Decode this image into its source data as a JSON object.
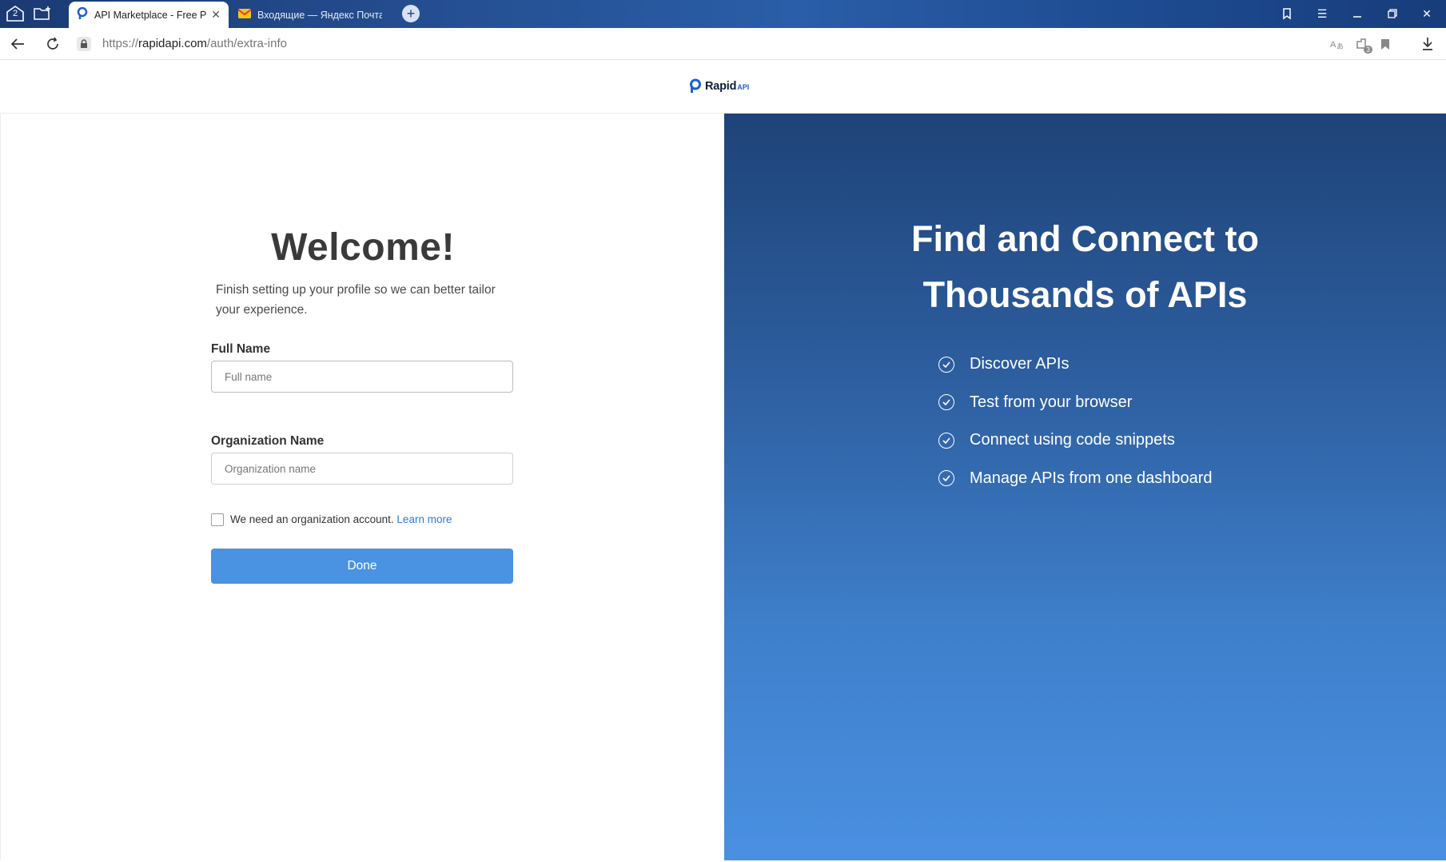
{
  "browser": {
    "tab_count_badge": "2",
    "tabs": [
      {
        "title": "API Marketplace - Free Public & Open Rest APIs",
        "active": true
      },
      {
        "title": "Входящие — Яндекс Почта",
        "active": false
      }
    ],
    "url_prefix": "https://",
    "url_host": "rapidapi.com",
    "url_path": "/auth/extra-info",
    "extensions_badge": "3"
  },
  "header": {
    "logo_text": "Rapid",
    "logo_suffix": "API"
  },
  "form": {
    "title": "Welcome!",
    "subtitle": "Finish setting up your profile so we can better tailor your experience.",
    "full_name_label": "Full Name",
    "full_name_placeholder": "Full name",
    "org_label": "Organization Name",
    "org_placeholder": "Organization name",
    "checkbox_text": "We need an organization account.",
    "learn_more": "Learn more",
    "done_label": "Done"
  },
  "promo": {
    "headline_line1": "Find and Connect to",
    "headline_line2": "Thousands of APIs",
    "features": [
      "Discover APIs",
      "Test from your browser",
      "Connect using code snippets",
      "Manage APIs from one dashboard"
    ]
  },
  "colors": {
    "primary_button": "#4a92e2",
    "link": "#2e7bd6",
    "panel_top": "#1e4378",
    "panel_bottom": "#4a90e1"
  }
}
